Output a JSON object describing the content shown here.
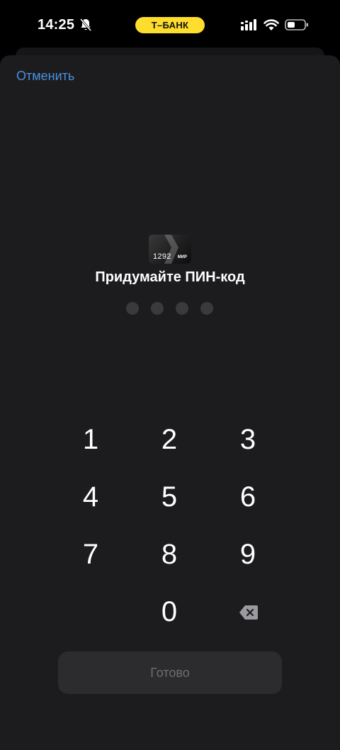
{
  "status_bar": {
    "time": "14:25",
    "bank_label": "Т–БАНК"
  },
  "header": {
    "cancel_label": "Отменить"
  },
  "card": {
    "number": "1292",
    "brand": "МИР"
  },
  "title": "Придумайте ПИН-код",
  "pin": {
    "length": 4,
    "filled": 0
  },
  "keypad": {
    "k1": "1",
    "k2": "2",
    "k3": "3",
    "k4": "4",
    "k5": "5",
    "k6": "6",
    "k7": "7",
    "k8": "8",
    "k9": "9",
    "k0": "0",
    "delete_icon": "backspace-icon"
  },
  "done_label": "Готово",
  "colors": {
    "accent_link": "#4a90e2",
    "brand_yellow": "#ffdd2d",
    "sheet_bg": "#1c1c1e"
  }
}
